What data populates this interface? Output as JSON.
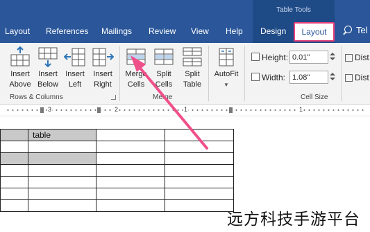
{
  "ribbon_tabs": [
    "Layout",
    "References",
    "Mailings",
    "Review",
    "View",
    "Help",
    "Design"
  ],
  "active_tab": "Layout",
  "context_title": "Table Tools",
  "search_text": "Tel",
  "rows_columns": {
    "commands": [
      {
        "line1": "Insert",
        "line2": "Above",
        "icon": "insert-above-icon"
      },
      {
        "line1": "Insert",
        "line2": "Below",
        "icon": "insert-below-icon"
      },
      {
        "line1": "Insert",
        "line2": "Left",
        "icon": "insert-left-icon"
      },
      {
        "line1": "Insert",
        "line2": "Right",
        "icon": "insert-right-icon"
      }
    ],
    "group_label": "Rows & Columns"
  },
  "merge": {
    "commands": [
      {
        "line1": "Merge",
        "line2": "Cells",
        "icon": "merge-cells-icon"
      },
      {
        "line1": "Split",
        "line2": "Cells",
        "icon": "split-cells-icon"
      },
      {
        "line1": "Split",
        "line2": "Table",
        "icon": "split-table-icon"
      }
    ],
    "group_label": "Merge"
  },
  "autofit": {
    "label": "AutoFit",
    "icon": "autofit-icon",
    "dropdown_icon": "chevron-down-icon"
  },
  "cell_size": {
    "height_label": "Height:",
    "height_value": "0.01\"",
    "width_label": "Width:",
    "width_value": "1.08\"",
    "group_label": "Cell Size"
  },
  "distribute": {
    "rows_label": "Dist",
    "cols_label": "Dist"
  },
  "ruler": {
    "numbers": [
      "3",
      "2",
      "1",
      "1"
    ]
  },
  "table": {
    "rows": [
      [
        "",
        "table",
        "",
        ""
      ],
      [
        "",
        "",
        "",
        ""
      ],
      [
        "",
        "",
        "",
        ""
      ],
      [
        "",
        "",
        "",
        ""
      ],
      [
        "",
        "",
        "",
        ""
      ],
      [
        "",
        "",
        "",
        ""
      ],
      [
        "",
        "",
        "",
        ""
      ]
    ]
  },
  "colors": {
    "ribbon_blue": "#2b579a",
    "highlight": "#e8407a",
    "cell_shade": "#c9c9c9"
  },
  "watermark": "远方科技手游平台"
}
